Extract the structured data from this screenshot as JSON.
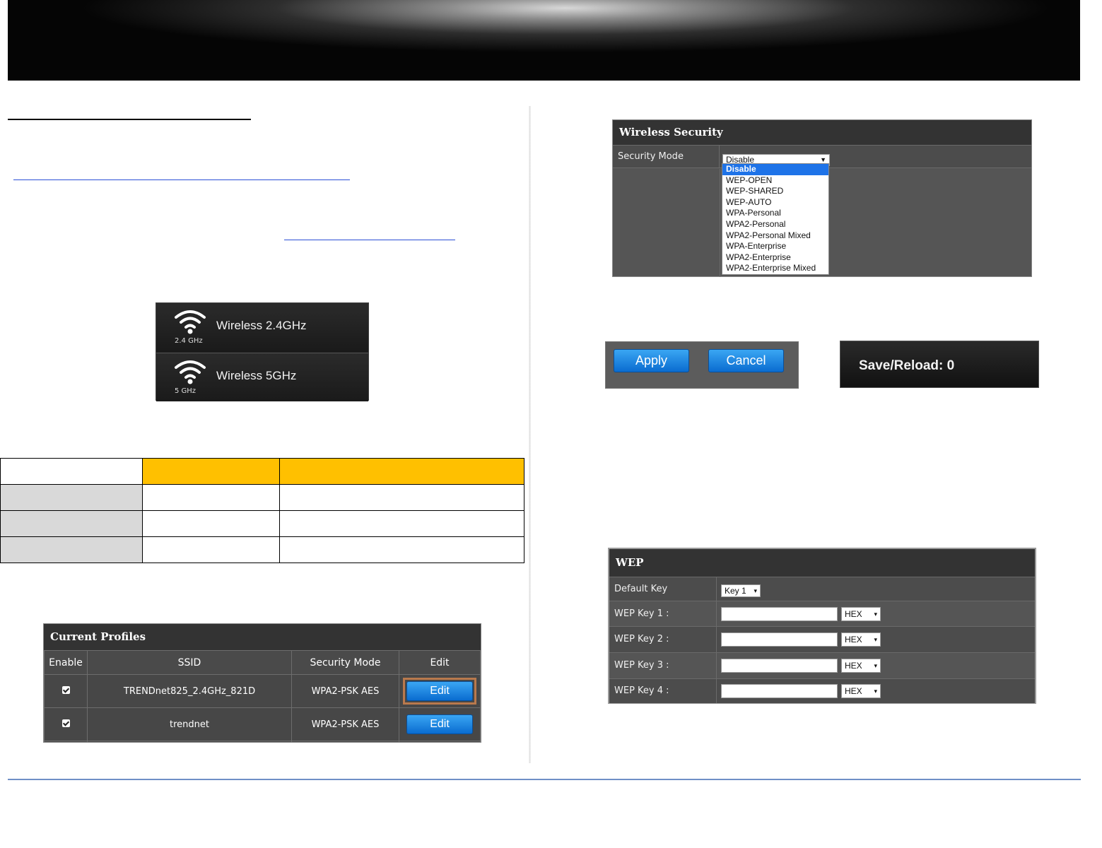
{
  "band_selector": {
    "items": [
      {
        "label": "Wireless 2.4GHz",
        "sub": "2.4 GHz"
      },
      {
        "label": "Wireless 5GHz",
        "sub": "5 GHz"
      }
    ]
  },
  "current_profiles": {
    "title": "Current Profiles",
    "columns": [
      "Enable",
      "SSID",
      "Security Mode",
      "Edit"
    ],
    "rows": [
      {
        "ssid": "TRENDnet825_2.4GHz_821D",
        "security": "WPA2-PSK AES",
        "edit": "Edit"
      },
      {
        "ssid": "trendnet",
        "security": "WPA2-PSK AES",
        "edit": "Edit"
      }
    ]
  },
  "wireless_security": {
    "title": "Wireless Security",
    "mode_label": "Security Mode",
    "selected": "Disable",
    "options": [
      "Disable",
      "WEP-OPEN",
      "WEP-SHARED",
      "WEP-AUTO",
      "WPA-Personal",
      "WPA2-Personal",
      "WPA2-Personal Mixed",
      "WPA-Enterprise",
      "WPA2-Enterprise",
      "WPA2-Enterprise Mixed"
    ]
  },
  "buttons": {
    "apply": "Apply",
    "cancel": "Cancel"
  },
  "save_reload": "Save/Reload: 0",
  "wep": {
    "title": "WEP",
    "default_key_label": "Default Key",
    "default_key_value": "Key 1",
    "keys": [
      {
        "label": "WEP Key 1 :",
        "format": "HEX"
      },
      {
        "label": "WEP Key 2 :",
        "format": "HEX"
      },
      {
        "label": "WEP Key 3 :",
        "format": "HEX"
      },
      {
        "label": "WEP Key 4 :",
        "format": "HEX"
      }
    ]
  },
  "colors": {
    "table_header_accent": "#ffc000",
    "button_blue": "#1e88e5",
    "link_blue": "#2a4fd6"
  }
}
